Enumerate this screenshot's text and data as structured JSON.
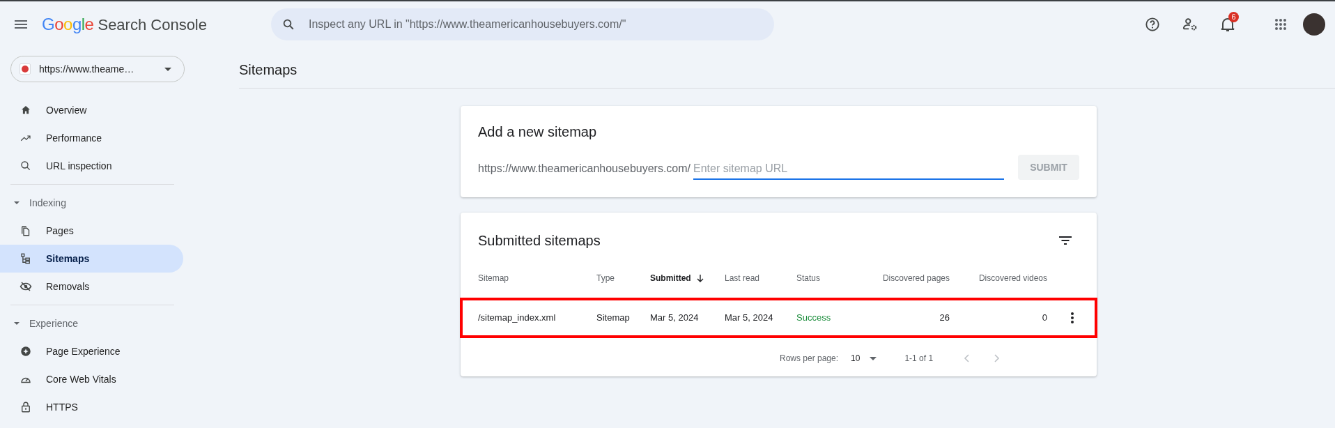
{
  "header": {
    "logo_word": "Google",
    "product": "Search Console",
    "search": {
      "placeholder": "Inspect any URL in \"https://www.theamericanhousebuyers.com/\""
    },
    "notification_count": "6"
  },
  "property": {
    "label": "https://www.theame…"
  },
  "sidebar": {
    "sections": [
      {
        "items": [
          {
            "label": "Overview",
            "selected": false
          },
          {
            "label": "Performance",
            "selected": false
          },
          {
            "label": "URL inspection",
            "selected": false
          }
        ]
      },
      {
        "title": "Indexing",
        "expanded": true,
        "items": [
          {
            "label": "Pages",
            "selected": false
          },
          {
            "label": "Sitemaps",
            "selected": true
          },
          {
            "label": "Removals",
            "selected": false
          }
        ]
      },
      {
        "title": "Experience",
        "expanded": true,
        "items": [
          {
            "label": "Page Experience",
            "selected": false
          },
          {
            "label": "Core Web Vitals",
            "selected": false
          },
          {
            "label": "HTTPS",
            "selected": false
          }
        ]
      }
    ]
  },
  "page_title": "Sitemaps",
  "add_card": {
    "title": "Add a new sitemap",
    "prefix": "https://www.theamericanhousebuyers.com/",
    "placeholder": "Enter sitemap URL",
    "submit": {
      "label": "SUBMIT",
      "disabled": true
    }
  },
  "table": {
    "title": "Submitted sitemaps",
    "columns": [
      {
        "label": "Sitemap",
        "kind": "text",
        "sorted": false
      },
      {
        "label": "Type",
        "kind": "text",
        "sorted": false
      },
      {
        "label": "Submitted",
        "kind": "text",
        "sorted": true
      },
      {
        "label": "Last read",
        "kind": "text",
        "sorted": false
      },
      {
        "label": "Status",
        "kind": "status",
        "sorted": false
      },
      {
        "label": "Discovered pages",
        "kind": "number",
        "sorted": false
      },
      {
        "label": "Discovered videos",
        "kind": "number",
        "sorted": false
      }
    ],
    "rows": [
      {
        "highlighted": true,
        "cells": [
          "/sitemap_index.xml",
          "Sitemap",
          "Mar 5, 2024",
          "Mar 5, 2024",
          "Success",
          "26",
          "0"
        ]
      }
    ],
    "footer": {
      "rows_per_page_label": "Rows per page:",
      "rows_per_page": "10",
      "range": "1-1 of 1"
    }
  }
}
